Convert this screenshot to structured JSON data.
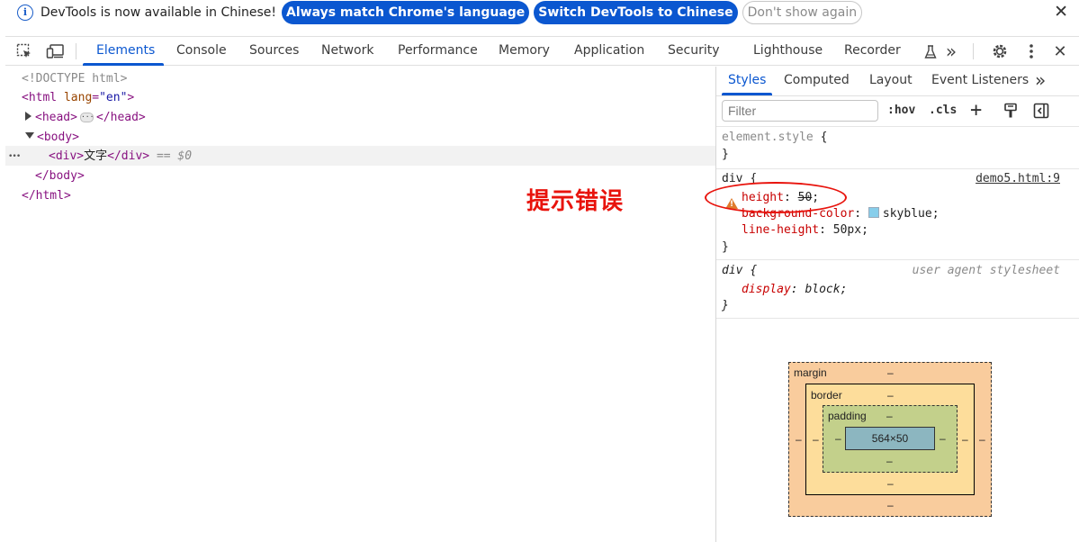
{
  "infobar": {
    "message": "DevTools is now available in Chinese!",
    "btn_match": "Always match Chrome's language",
    "btn_switch": "Switch DevTools to Chinese",
    "btn_dismiss": "Don't show again",
    "close": "✕",
    "info_glyph": "i"
  },
  "toolbar": {
    "tabs": [
      "Elements",
      "Console",
      "Sources",
      "Network",
      "Performance",
      "Memory",
      "Application",
      "Security",
      "Lighthouse",
      "Recorder"
    ],
    "active_tab": "Elements",
    "more": "»",
    "close": "✕"
  },
  "dom": {
    "doctype": "<!DOCTYPE html>",
    "html_open": "<html",
    "lang_attr": "lang",
    "lang_val": "\"en\"",
    "html_open_end": ">",
    "head_open": "<head>",
    "head_close": "</head>",
    "body_open": "<body>",
    "div_open": "<div>",
    "div_text": "文字",
    "div_close": "</div>",
    "selected_ref": "== $0",
    "body_close": "</body>",
    "html_close": "</html>",
    "row_dots": "•••",
    "ellipsis": "···"
  },
  "annotation": {
    "text": "提示错误",
    "color": "#e8130c"
  },
  "styles": {
    "subtabs": [
      "Styles",
      "Computed",
      "Layout",
      "Event Listeners"
    ],
    "active_subtab": "Styles",
    "subtabs_more": "»",
    "filter_placeholder": "Filter",
    "hov": ":hov",
    "cls": ".cls",
    "add": "+",
    "element_style": {
      "selector": "element.style",
      "open": "{",
      "close": "}"
    },
    "div_rule": {
      "selector": "div",
      "open": "{",
      "source": "demo5.html:9",
      "props": [
        {
          "name": "height",
          "value": "50",
          "invalid": true,
          "warning": true
        },
        {
          "name": "background-color",
          "value": "skyblue",
          "swatch": "skyblue"
        },
        {
          "name": "line-height",
          "value": "50px"
        }
      ],
      "close": "}"
    },
    "ua_rule": {
      "selector": "div",
      "open": "{",
      "source": "user agent stylesheet",
      "props": [
        {
          "name": "display",
          "value": "block"
        }
      ],
      "close": "}"
    }
  },
  "box_model": {
    "margin_label": "margin",
    "border_label": "border",
    "padding_label": "padding",
    "dash": "–",
    "content_size": "564×50",
    "colors": {
      "margin": "#f9cc9d",
      "border": "#fddd9b",
      "padding": "#c3d08b",
      "content": "#8cb6c0"
    }
  }
}
